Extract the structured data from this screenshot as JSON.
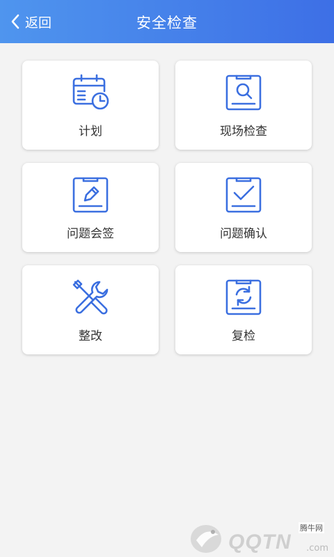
{
  "header": {
    "back_label": "返回",
    "title": "安全检查"
  },
  "menu": [
    {
      "label": "计划",
      "icon": "calendar-clock-icon"
    },
    {
      "label": "现场检查",
      "icon": "clipboard-search-icon"
    },
    {
      "label": "问题会签",
      "icon": "clipboard-edit-icon"
    },
    {
      "label": "问题确认",
      "icon": "clipboard-check-icon"
    },
    {
      "label": "整改",
      "icon": "wrench-screwdriver-icon"
    },
    {
      "label": "复检",
      "icon": "clipboard-refresh-icon"
    }
  ],
  "watermark": {
    "text": "QQTN",
    "small_text": "腾牛网",
    "suffix": ".com"
  },
  "colors": {
    "header_start": "#4f95ee",
    "header_end": "#3d6fe6",
    "icon_blue": "#3b6fe0",
    "background": "#f3f3f3"
  }
}
